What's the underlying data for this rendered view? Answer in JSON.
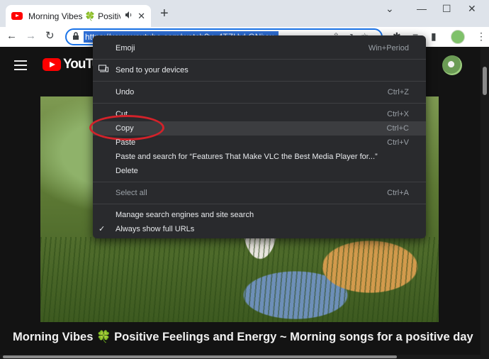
{
  "tab": {
    "title": "Morning Vibes 🍀 Positive F",
    "audio_icon": "speaker-icon",
    "close_glyph": "✕"
  },
  "new_tab_glyph": "+",
  "window": {
    "minimize": "⌄",
    "min2": "—",
    "max": "☐",
    "close": "✕"
  },
  "toolbar": {
    "back": "←",
    "forward": "→",
    "reload": "↻",
    "url": "https://www.youtube.com/watch?v=4TZHyLGNiyw",
    "menu_dots": "⋮"
  },
  "youtube": {
    "logo_text": "YouTube"
  },
  "video": {
    "title_part1": "Morning Vibes",
    "clover": "🍀",
    "title_part2": "Positive Feelings and Energy ~ Morning songs for a positive day"
  },
  "context_menu": {
    "items": [
      {
        "label": "Emoji",
        "shortcut": "Win+Period"
      },
      {
        "label": "Send to your devices",
        "shortcut": ""
      },
      {
        "label": "Undo",
        "shortcut": "Ctrl+Z"
      },
      {
        "label": "Cut",
        "shortcut": "Ctrl+X"
      },
      {
        "label": "Copy",
        "shortcut": "Ctrl+C"
      },
      {
        "label": "Paste",
        "shortcut": "Ctrl+V"
      },
      {
        "label": "Paste and search for “Features That Make VLC the Best Media Player for...”",
        "shortcut": ""
      },
      {
        "label": "Delete",
        "shortcut": ""
      },
      {
        "label": "Select all",
        "shortcut": "Ctrl+A"
      },
      {
        "label": "Manage search engines and site search",
        "shortcut": ""
      },
      {
        "label": "Always show full URLs",
        "shortcut": ""
      }
    ],
    "checkmark": "✓"
  },
  "colors": {
    "highlight_ring": "#d3222a",
    "youtube_red": "#ff0000",
    "omnibox_focus": "#1a73e8"
  }
}
